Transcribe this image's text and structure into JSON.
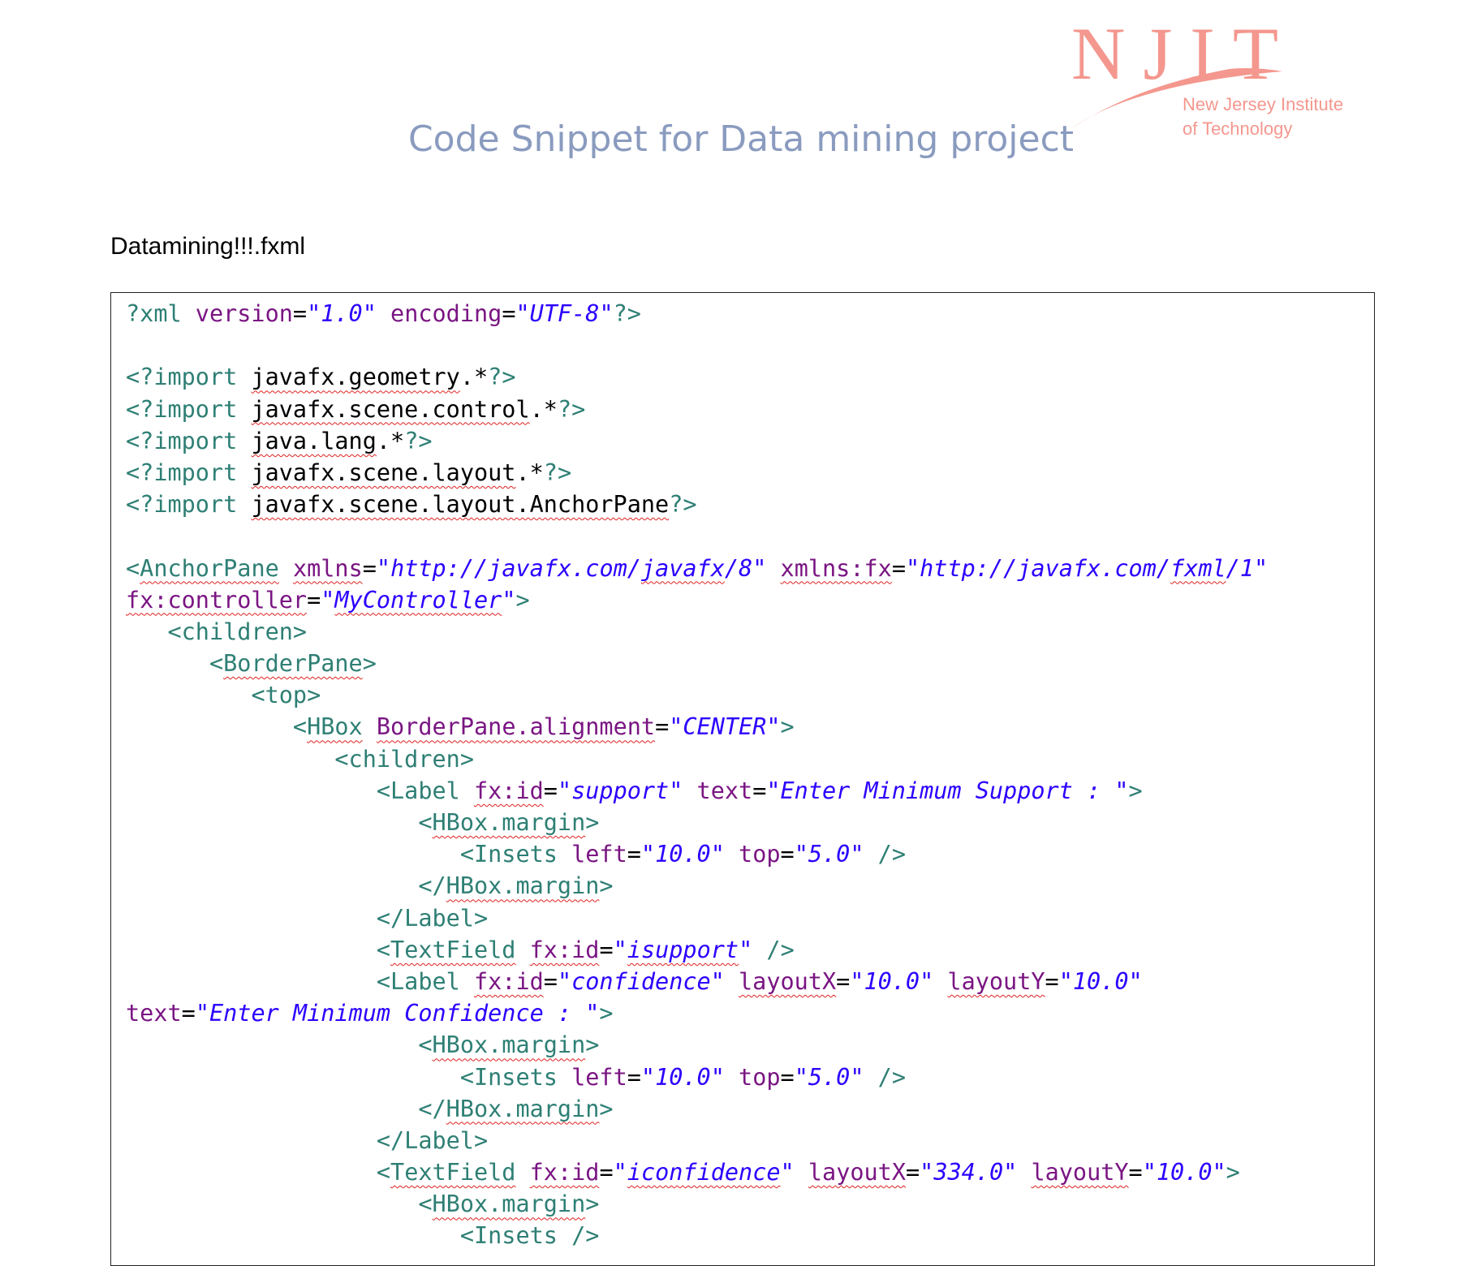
{
  "logo": {
    "letters": "NJIT",
    "line1": "New Jersey Institute",
    "line2": "of Technology",
    "color": "#f4978e"
  },
  "title": "Code Snippet for Data mining project",
  "filename": "Datamining!!!.fxml",
  "colors": {
    "tag": "#2e7f74",
    "attribute": "#7a1583",
    "value": "#2a00ff",
    "plain": "#000000",
    "squiggle": "#e02020",
    "title": "#8a9bbf"
  },
  "code_lines": [
    [
      [
        "t",
        "?xml "
      ],
      [
        "a",
        "version"
      ],
      [
        "p",
        "="
      ],
      [
        "v",
        "\"1.0\""
      ],
      [
        "p",
        " "
      ],
      [
        "a",
        "encoding"
      ],
      [
        "p",
        "="
      ],
      [
        "v",
        "\"UTF-8\""
      ],
      [
        "t",
        "?>"
      ]
    ],
    [],
    [
      [
        "t",
        "<?import "
      ],
      [
        "ps",
        "javafx.geometry"
      ],
      [
        "p",
        ".*"
      ],
      [
        "t",
        "?>"
      ]
    ],
    [
      [
        "t",
        "<?import "
      ],
      [
        "ps",
        "javafx.scene.control"
      ],
      [
        "p",
        ".*"
      ],
      [
        "t",
        "?>"
      ]
    ],
    [
      [
        "t",
        "<?import "
      ],
      [
        "ps",
        "java.lang"
      ],
      [
        "p",
        ".*"
      ],
      [
        "t",
        "?>"
      ]
    ],
    [
      [
        "t",
        "<?import "
      ],
      [
        "ps",
        "javafx.scene.layout"
      ],
      [
        "p",
        ".*"
      ],
      [
        "t",
        "?>"
      ]
    ],
    [
      [
        "t",
        "<?import "
      ],
      [
        "ps",
        "javafx.scene.layout.AnchorPane"
      ],
      [
        "t",
        "?>"
      ]
    ],
    [],
    [
      [
        "t",
        "<"
      ],
      [
        "ts",
        "AnchorPane"
      ],
      [
        "p",
        " "
      ],
      [
        "as",
        "xmlns"
      ],
      [
        "p",
        "="
      ],
      [
        "v",
        "\"http://javafx.com/"
      ],
      [
        "vs",
        "javafx"
      ],
      [
        "v",
        "/8\""
      ],
      [
        "p",
        " "
      ],
      [
        "as",
        "xmlns:fx"
      ],
      [
        "p",
        "="
      ],
      [
        "v",
        "\"http://javafx.com/"
      ],
      [
        "vs",
        "fxml"
      ],
      [
        "v",
        "/1\""
      ]
    ],
    [
      [
        "as",
        "fx:controller"
      ],
      [
        "p",
        "="
      ],
      [
        "v",
        "\""
      ],
      [
        "vs",
        "MyController"
      ],
      [
        "v",
        "\""
      ],
      [
        "t",
        ">"
      ]
    ],
    [
      [
        "p",
        "   "
      ],
      [
        "t",
        "<children>"
      ]
    ],
    [
      [
        "p",
        "      "
      ],
      [
        "t",
        "<"
      ],
      [
        "ts",
        "BorderPane"
      ],
      [
        "t",
        ">"
      ]
    ],
    [
      [
        "p",
        "         "
      ],
      [
        "t",
        "<top>"
      ]
    ],
    [
      [
        "p",
        "            "
      ],
      [
        "t",
        "<"
      ],
      [
        "ts",
        "HBox"
      ],
      [
        "p",
        " "
      ],
      [
        "as",
        "BorderPane.alignment"
      ],
      [
        "p",
        "="
      ],
      [
        "v",
        "\"CENTER\""
      ],
      [
        "t",
        ">"
      ]
    ],
    [
      [
        "p",
        "               "
      ],
      [
        "t",
        "<children>"
      ]
    ],
    [
      [
        "p",
        "                  "
      ],
      [
        "t",
        "<Label "
      ],
      [
        "as",
        "fx:id"
      ],
      [
        "p",
        "="
      ],
      [
        "v",
        "\"support\""
      ],
      [
        "p",
        " "
      ],
      [
        "a",
        "text"
      ],
      [
        "p",
        "="
      ],
      [
        "v",
        "\"Enter Minimum Support : \""
      ],
      [
        "t",
        ">"
      ]
    ],
    [
      [
        "p",
        "                     "
      ],
      [
        "t",
        "<"
      ],
      [
        "ts",
        "HBox.margin"
      ],
      [
        "t",
        ">"
      ]
    ],
    [
      [
        "p",
        "                        "
      ],
      [
        "t",
        "<Insets "
      ],
      [
        "a",
        "left"
      ],
      [
        "p",
        "="
      ],
      [
        "v",
        "\"10.0\""
      ],
      [
        "p",
        " "
      ],
      [
        "a",
        "top"
      ],
      [
        "p",
        "="
      ],
      [
        "v",
        "\"5.0\""
      ],
      [
        "p",
        " "
      ],
      [
        "t",
        "/>"
      ]
    ],
    [
      [
        "p",
        "                     "
      ],
      [
        "t",
        "</"
      ],
      [
        "ts",
        "HBox.margin"
      ],
      [
        "t",
        ">"
      ]
    ],
    [
      [
        "p",
        "                  "
      ],
      [
        "t",
        "</Label>"
      ]
    ],
    [
      [
        "p",
        "                  "
      ],
      [
        "t",
        "<"
      ],
      [
        "ts",
        "TextField"
      ],
      [
        "p",
        " "
      ],
      [
        "as",
        "fx:id"
      ],
      [
        "p",
        "="
      ],
      [
        "v",
        "\""
      ],
      [
        "vs",
        "isupport"
      ],
      [
        "v",
        "\""
      ],
      [
        "p",
        " "
      ],
      [
        "t",
        "/>"
      ]
    ],
    [
      [
        "p",
        "                  "
      ],
      [
        "t",
        "<Label "
      ],
      [
        "as",
        "fx:id"
      ],
      [
        "p",
        "="
      ],
      [
        "v",
        "\"confidence\""
      ],
      [
        "p",
        " "
      ],
      [
        "as",
        "layoutX"
      ],
      [
        "p",
        "="
      ],
      [
        "v",
        "\"10.0\""
      ],
      [
        "p",
        " "
      ],
      [
        "as",
        "layoutY"
      ],
      [
        "p",
        "="
      ],
      [
        "v",
        "\"10.0\""
      ]
    ],
    [
      [
        "a",
        "text"
      ],
      [
        "p",
        "="
      ],
      [
        "v",
        "\"Enter Minimum Confidence : \""
      ],
      [
        "t",
        ">"
      ]
    ],
    [
      [
        "p",
        "                     "
      ],
      [
        "t",
        "<"
      ],
      [
        "ts",
        "HBox.margin"
      ],
      [
        "t",
        ">"
      ]
    ],
    [
      [
        "p",
        "                        "
      ],
      [
        "t",
        "<Insets "
      ],
      [
        "a",
        "left"
      ],
      [
        "p",
        "="
      ],
      [
        "v",
        "\"10.0\""
      ],
      [
        "p",
        " "
      ],
      [
        "a",
        "top"
      ],
      [
        "p",
        "="
      ],
      [
        "v",
        "\"5.0\""
      ],
      [
        "p",
        " "
      ],
      [
        "t",
        "/>"
      ]
    ],
    [
      [
        "p",
        "                     "
      ],
      [
        "t",
        "</"
      ],
      [
        "ts",
        "HBox.margin"
      ],
      [
        "t",
        ">"
      ]
    ],
    [
      [
        "p",
        "                  "
      ],
      [
        "t",
        "</Label>"
      ]
    ],
    [
      [
        "p",
        "                  "
      ],
      [
        "t",
        "<"
      ],
      [
        "ts",
        "TextField"
      ],
      [
        "p",
        " "
      ],
      [
        "as",
        "fx:id"
      ],
      [
        "p",
        "="
      ],
      [
        "v",
        "\""
      ],
      [
        "vs",
        "iconfidence"
      ],
      [
        "v",
        "\""
      ],
      [
        "p",
        " "
      ],
      [
        "as",
        "layoutX"
      ],
      [
        "p",
        "="
      ],
      [
        "v",
        "\"334.0\""
      ],
      [
        "p",
        " "
      ],
      [
        "as",
        "layoutY"
      ],
      [
        "p",
        "="
      ],
      [
        "v",
        "\"10.0\""
      ],
      [
        "t",
        ">"
      ]
    ],
    [
      [
        "p",
        "                     "
      ],
      [
        "t",
        "<"
      ],
      [
        "ts",
        "HBox.margin"
      ],
      [
        "t",
        ">"
      ]
    ],
    [
      [
        "p",
        "                        "
      ],
      [
        "t",
        "<Insets />"
      ]
    ]
  ]
}
